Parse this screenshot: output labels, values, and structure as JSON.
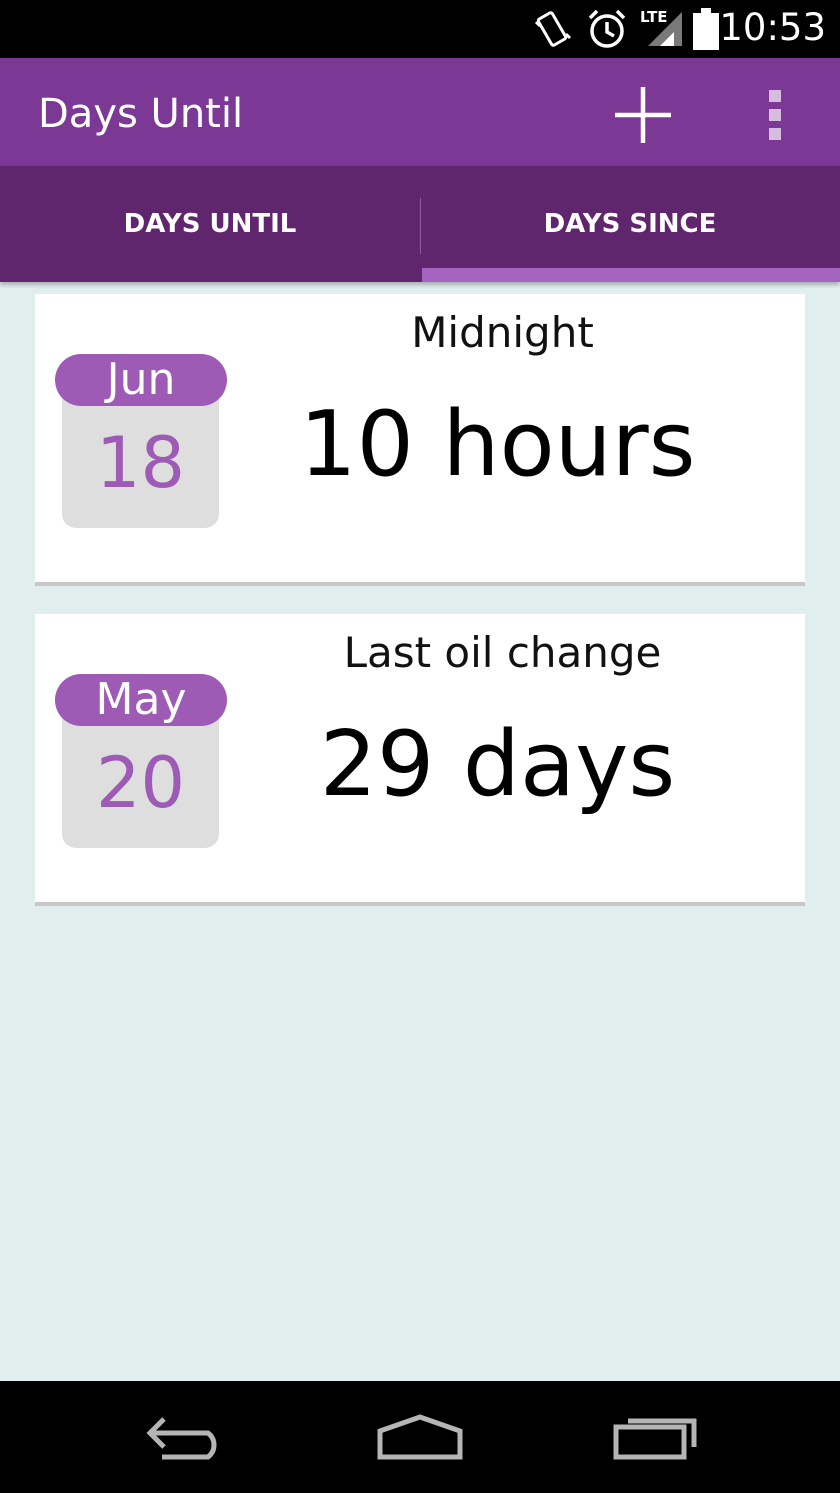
{
  "status_bar": {
    "time": "10:53",
    "network_label": "LTE",
    "icons": [
      "vibrate-icon",
      "alarm-icon",
      "signal-icon",
      "battery-icon"
    ]
  },
  "action_bar": {
    "title": "Days Until",
    "actions": [
      "add-icon",
      "overflow-menu-icon"
    ],
    "color": "#7b3894"
  },
  "tabs": [
    {
      "label": "DAYS UNTIL",
      "selected": false
    },
    {
      "label": "DAYS SINCE",
      "selected": true
    }
  ],
  "events": [
    {
      "month": "Jun",
      "day": "18",
      "title": "Midnight",
      "value": "10 hours"
    },
    {
      "month": "May",
      "day": "20",
      "title": "Last oil change",
      "value": "29 days"
    }
  ],
  "nav_bar": {
    "icons": [
      "back-icon",
      "home-icon",
      "recents-icon"
    ]
  },
  "colors": {
    "primary": "#7b3894",
    "primary_dark": "#5f266e",
    "accent": "#9d5bb5",
    "background": "#e0eeee"
  }
}
